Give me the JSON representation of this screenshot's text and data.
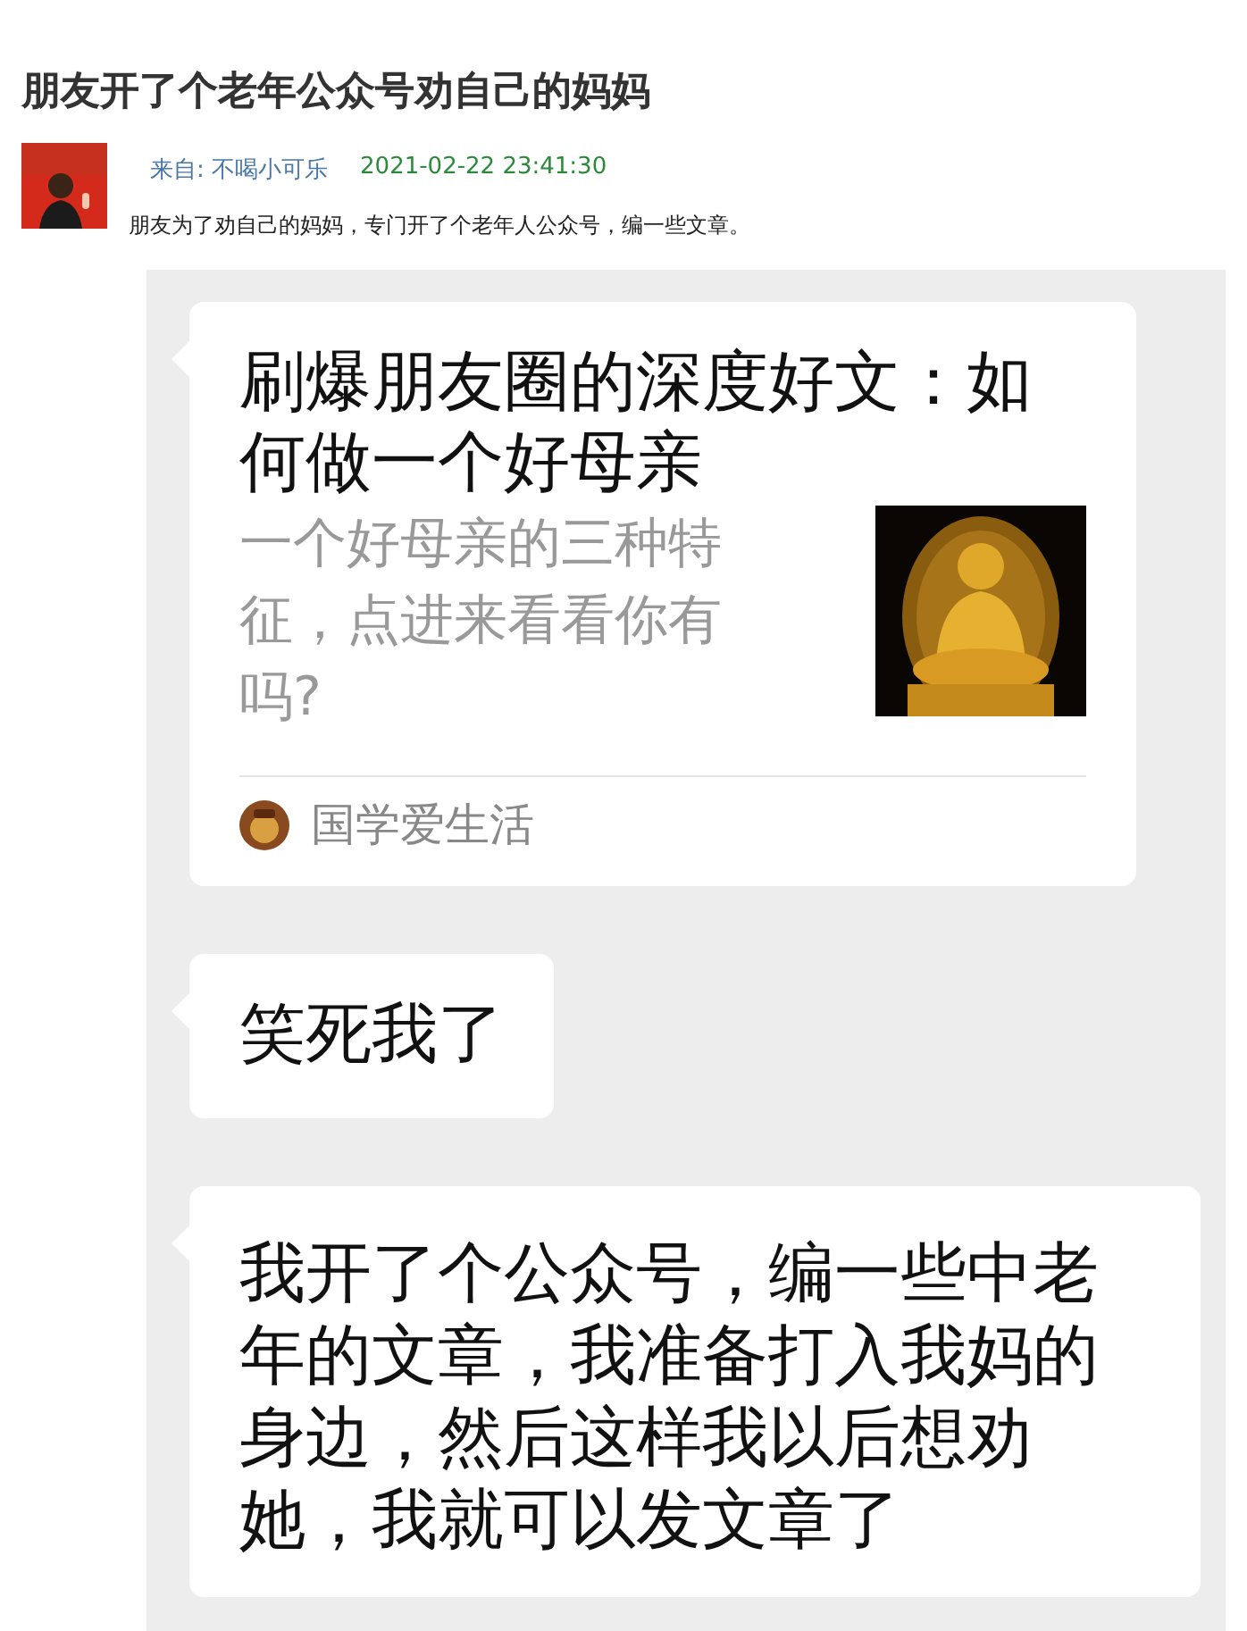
{
  "post": {
    "title": "朋友开了个老年公众号劝自己的妈妈",
    "source_label": "来自:",
    "author": "不喝小可乐",
    "time": "2021-02-22 23:41:30",
    "summary": "朋友为了劝自己的妈妈，专门开了个老年人公众号，编一些文章。"
  },
  "chat": {
    "messages": [
      {
        "kind": "article",
        "title": "刷爆朋友圈的深度好文：如何做一个好母亲",
        "description": "一个好母亲的三种特征，点进来看看你有吗?",
        "account": "国学爱生活"
      },
      {
        "kind": "text",
        "text": "笑死我了"
      },
      {
        "kind": "text",
        "text": "我开了个公众号，编一些中老年的文章，我准备打入我妈的身边，然后这样我以后想劝她，我就可以发文章了"
      }
    ]
  }
}
